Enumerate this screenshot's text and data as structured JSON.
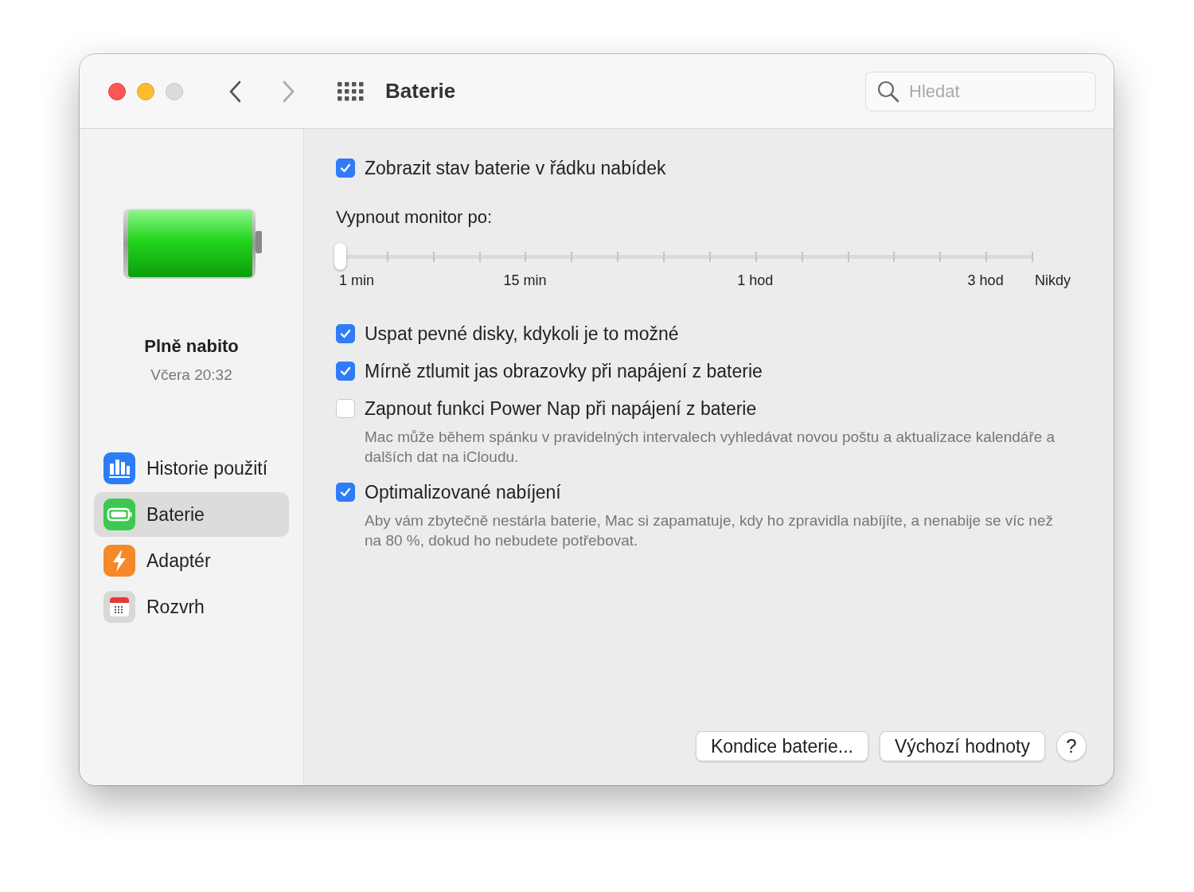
{
  "window": {
    "title": "Baterie"
  },
  "search": {
    "placeholder": "Hledat"
  },
  "sidebar": {
    "status": "Plně nabito",
    "time": "Včera 20:32",
    "items": [
      {
        "label": "Historie použití",
        "selected": false
      },
      {
        "label": "Baterie",
        "selected": true
      },
      {
        "label": "Adaptér",
        "selected": false
      },
      {
        "label": "Rozvrh",
        "selected": false
      }
    ]
  },
  "menu_bar_option": {
    "label": "Zobrazit stav baterie v řádku nabídek",
    "checked": true
  },
  "slider": {
    "label": "Vypnout monitor po:",
    "level": 0,
    "labels": [
      "1 min",
      "15 min",
      "1 hod",
      "3 hod",
      "Nikdy"
    ]
  },
  "options": [
    {
      "label": "Uspat pevné disky, kdykoli je to možné",
      "checked": true
    },
    {
      "label": "Mírně ztlumit jas obrazovky při napájení z baterie",
      "checked": true
    },
    {
      "label": "Zapnout funkci Power Nap při napájení z baterie",
      "checked": false,
      "description": "Mac může během spánku v pravidelných intervalech vyhledávat novou poštu a aktualizace kalendáře a dalších dat na iCloudu."
    },
    {
      "label": "Optimalizované nabíjení",
      "checked": true,
      "description": "Aby vám zbytečně nestárla baterie, Mac si zapamatuje, kdy ho zpravidla nabíjíte, a nenabije se víc než na 80 %, dokud ho nebudete potřebovat."
    }
  ],
  "buttons": [
    {
      "label": "Kondice baterie..."
    },
    {
      "label": "Výchozí hodnoty"
    }
  ],
  "help_button": "?"
}
